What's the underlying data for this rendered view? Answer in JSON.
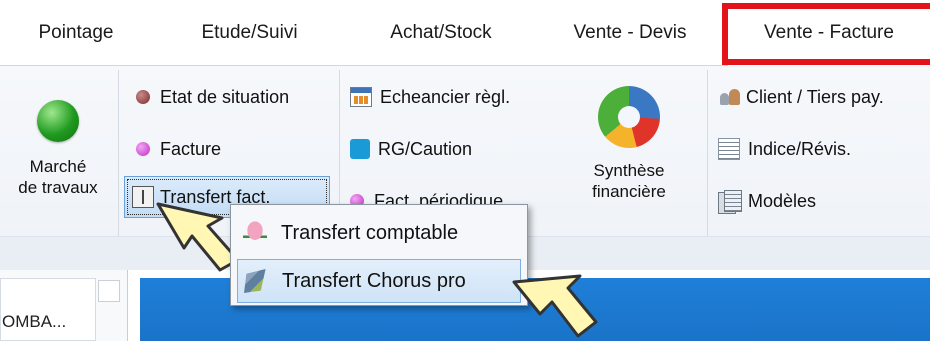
{
  "tabs": [
    {
      "label": "Pointage",
      "active": false
    },
    {
      "label": "Etude/Suivi",
      "active": false
    },
    {
      "label": "Achat/Stock",
      "active": false
    },
    {
      "label": "Vente - Devis",
      "active": false
    },
    {
      "label": "Vente - Facture",
      "active": true
    }
  ],
  "ribbon": {
    "marche_line1": "Marché",
    "marche_line2": "de travaux",
    "etat_situation": "Etat de situation",
    "facture": "Facture",
    "transfert_fact": "Transfert fact.",
    "echeancier": "Echeancier règl.",
    "rg_caution": "RG/Caution",
    "fact_periodique": "Fact. périodique",
    "synthese_line1": "Synthèse",
    "synthese_line2": "financière",
    "client_tiers": "Client / Tiers pay.",
    "indice_revis": "Indice/Révis.",
    "modeles": "Modèles"
  },
  "popup_menu": {
    "items": [
      {
        "label": "Transfert comptable",
        "icon": "tulip-icon",
        "highlighted": false
      },
      {
        "label": "Transfert Chorus pro",
        "icon": "chorus-icon",
        "highlighted": true
      }
    ]
  },
  "lower": {
    "left_text": "OMBA..."
  },
  "colors": {
    "highlight_box": "#e3131b",
    "callout": "#fff7b3"
  }
}
